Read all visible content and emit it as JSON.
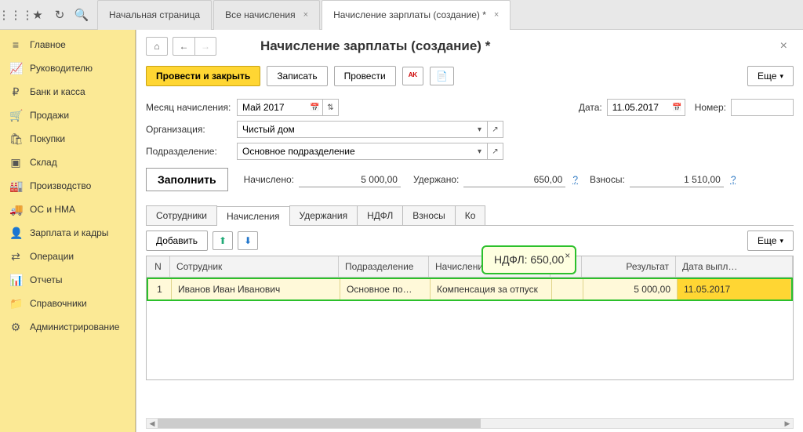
{
  "topbar": {
    "tabs": [
      {
        "label": "Начальная страница"
      },
      {
        "label": "Все начисления"
      },
      {
        "label": "Начисление зарплаты (создание) *",
        "active": true
      }
    ]
  },
  "sidebar": {
    "items": [
      {
        "icon": "≡",
        "label": "Главное"
      },
      {
        "icon": "📈",
        "label": "Руководителю"
      },
      {
        "icon": "₽",
        "label": "Банк и касса"
      },
      {
        "icon": "🛒",
        "label": "Продажи"
      },
      {
        "icon": "🛍",
        "label": "Покупки"
      },
      {
        "icon": "▣",
        "label": "Склад"
      },
      {
        "icon": "🏭",
        "label": "Производство"
      },
      {
        "icon": "🚚",
        "label": "ОС и НМА"
      },
      {
        "icon": "👤",
        "label": "Зарплата и кадры"
      },
      {
        "icon": "⇄",
        "label": "Операции"
      },
      {
        "icon": "📊",
        "label": "Отчеты"
      },
      {
        "icon": "📁",
        "label": "Справочники"
      },
      {
        "icon": "⚙",
        "label": "Администрирование"
      }
    ]
  },
  "page": {
    "title": "Начисление зарплаты (создание) *",
    "btn_post_close": "Провести и закрыть",
    "btn_write": "Записать",
    "btn_post": "Провести",
    "btn_more": "Еще"
  },
  "form": {
    "month_label": "Месяц начисления:",
    "month_value": "Май 2017",
    "date_label": "Дата:",
    "date_value": "11.05.2017",
    "number_label": "Номер:",
    "number_value": "",
    "org_label": "Организация:",
    "org_value": "Чистый дом",
    "dep_label": "Подразделение:",
    "dep_value": "Основное подразделение",
    "fill_btn": "Заполнить",
    "accrued_label": "Начислено:",
    "accrued_value": "5 000,00",
    "withheld_label": "Удержано:",
    "withheld_value": "650,00",
    "contrib_label": "Взносы:",
    "contrib_value": "1 510,00"
  },
  "subtabs": [
    "Сотрудники",
    "Начисления",
    "Удержания",
    "НДФЛ",
    "Взносы",
    "Ко"
  ],
  "subtab_active": 1,
  "table": {
    "btn_add": "Добавить",
    "cols": [
      "N",
      "Сотрудник",
      "Подразделение",
      "Начисление",
      "",
      "Результат",
      "Дата выпл…"
    ],
    "row": {
      "n": "1",
      "emp": "Иванов Иван Иванович",
      "dep": "Основное по…",
      "acc": "Компенсация за отпуск",
      "res": "5 000,00",
      "date": "11.05.2017"
    }
  },
  "tooltip": "НДФЛ: 650,00"
}
